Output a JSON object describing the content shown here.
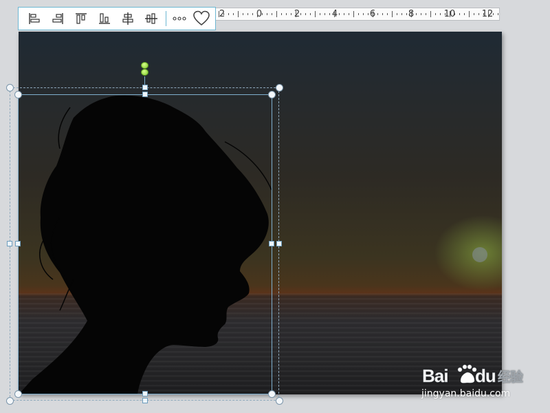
{
  "toolbar": {
    "buttons": [
      {
        "name": "align-left-icon"
      },
      {
        "name": "align-right-icon"
      },
      {
        "name": "align-top-icon"
      },
      {
        "name": "align-bottom-icon"
      },
      {
        "name": "align-horizontal-center-icon"
      },
      {
        "name": "align-vertical-center-icon"
      },
      {
        "name": "more-icon"
      },
      {
        "name": "heart-shape-icon"
      }
    ]
  },
  "ruler": {
    "labels": [
      "2",
      "0",
      "2",
      "4",
      "6",
      "8",
      "10",
      "12"
    ]
  },
  "watermark": {
    "logo_text": "Bai●du 经验",
    "url": "jingyan.baidu.com"
  },
  "colors": {
    "selection_border": "#7fb0cf",
    "rotation_handle": "#7cc62c",
    "toolbar_border": "#6cb7d3"
  }
}
